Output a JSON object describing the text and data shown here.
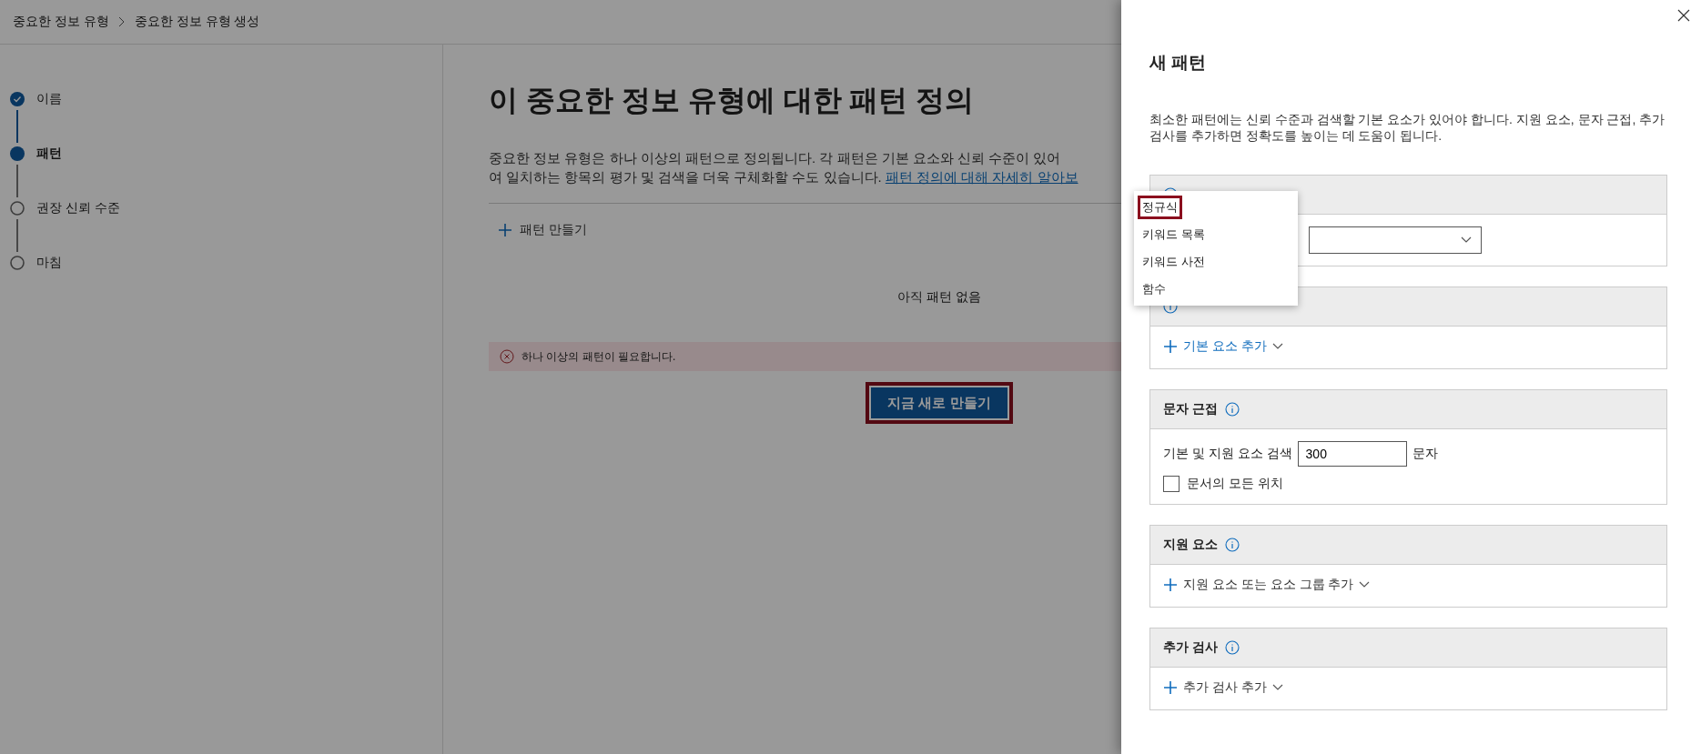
{
  "breadcrumb": [
    "중요한 정보 유형",
    "중요한 정보 유형 생성"
  ],
  "steps": [
    {
      "label": "이름",
      "completed": true,
      "current": false
    },
    {
      "label": "패턴",
      "completed": false,
      "current": true
    },
    {
      "label": "권장 신뢰 수준",
      "completed": false,
      "current": false
    },
    {
      "label": "마침",
      "completed": false,
      "current": false
    }
  ],
  "main": {
    "title": "이 중요한 정보 유형에 대한 패턴 정의",
    "description_lines": [
      "중요한 정보 유형은 하나 이상의 패턴으로 정의됩니다. 각 패턴은 기본 요소와 신뢰 수준이 있어",
      "여 일치하는 항목의 평가 및 검색을 더욱 구체화할 수도 있습니다."
    ],
    "link": "패턴 정의에 대해 자세히 알아보",
    "create_action": "패턴 만들기",
    "empty_text": "아직 패턴 없음",
    "error": "하나 이상의 패턴이 필요합니다.",
    "primary_button": {
      "label": "지금 새로 만들기",
      "annotated": true
    }
  },
  "panel": {
    "title": "새 패턴",
    "description": "최소한 패턴에는 신뢰 수준과 검색할 기본 요소가 있어야 합니다. 지원 요소, 문자 근접, 추가 검사를 추가하면 정확도를 높이는 데 도움이 됩니다.",
    "sections": [
      {
        "kind": "select"
      },
      {
        "kind": "add",
        "action": "기본 요소 추가",
        "link_color": true
      },
      {
        "kind": "proximity",
        "title": "문자 근접",
        "label": "기본 및 지원 요소 검색",
        "value": "300",
        "unit": "문자",
        "checkbox": {
          "label": "문서의 모든 위치",
          "checked": false
        }
      },
      {
        "kind": "add",
        "title": "지원 요소",
        "action": "지원 요소 또는 요소 그룹 추가",
        "link_color": false
      },
      {
        "kind": "add",
        "title": "추가 검사",
        "action": "추가 검사 추가",
        "link_color": false
      }
    ],
    "menu": [
      {
        "label": "정규식",
        "annotated": true
      },
      {
        "label": "키워드 목록",
        "annotated": false
      },
      {
        "label": "키워드 사전",
        "annotated": false
      },
      {
        "label": "함수",
        "annotated": false
      }
    ]
  }
}
